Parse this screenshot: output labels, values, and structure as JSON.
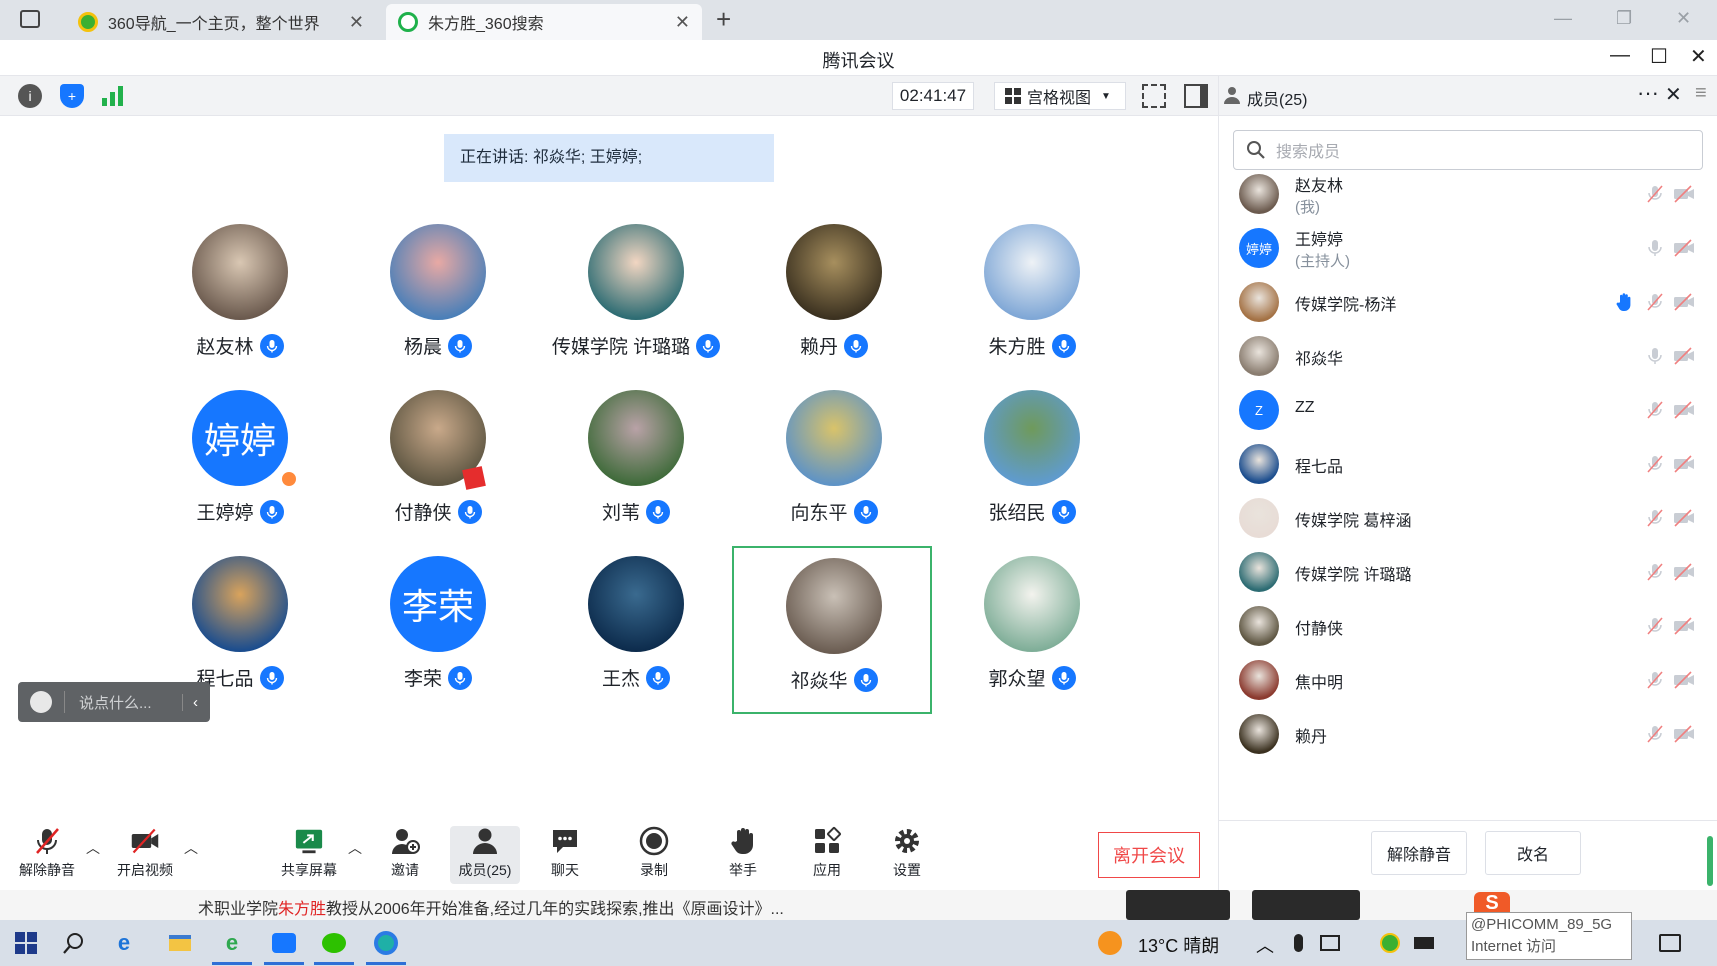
{
  "browser": {
    "tabs": [
      {
        "title": "360导航_一个主页，整个世界"
      },
      {
        "title": "朱方胜_360搜索"
      }
    ],
    "new_tab": "+"
  },
  "app": {
    "title": "腾讯会议"
  },
  "meeting": {
    "timer": "02:41:47",
    "view_mode": "宫格视图",
    "speaking_prefix": "正在讲话: ",
    "speaking_names": "祁焱华; 王婷婷;",
    "participants": [
      {
        "name": "赵友林",
        "avatar": "photo",
        "bg": "#6b5a4e",
        "bg2": "#d9c7b3"
      },
      {
        "name": "杨晨",
        "avatar": "photo",
        "bg": "#4a7fb8",
        "bg2": "#e8a9a4"
      },
      {
        "name": "传媒学院 许璐璐",
        "avatar": "photo",
        "bg": "#2d6c73",
        "bg2": "#f2d6c2"
      },
      {
        "name": "赖丹",
        "avatar": "photo",
        "bg": "#3b3120",
        "bg2": "#a78f5e"
      },
      {
        "name": "朱方胜",
        "avatar": "photo",
        "bg": "#7fa7d6",
        "bg2": "#eef2f6"
      },
      {
        "name": "王婷婷",
        "avatar": "text",
        "text": "婷婷",
        "host": true
      },
      {
        "name": "付静侠",
        "avatar": "photo",
        "bg": "#5e5642",
        "bg2": "#c9a98a",
        "flag": true
      },
      {
        "name": "刘苇",
        "avatar": "photo",
        "bg": "#3f6b3a",
        "bg2": "#b9a2a7"
      },
      {
        "name": "向东平",
        "avatar": "photo",
        "bg": "#5e93c6",
        "bg2": "#d9c36a"
      },
      {
        "name": "张绍民",
        "avatar": "photo",
        "bg": "#5f9bd0",
        "bg2": "#6f9a5b"
      },
      {
        "name": "程七品",
        "avatar": "photo",
        "bg": "#1b4d8e",
        "bg2": "#d9a35c"
      },
      {
        "name": "李荣",
        "avatar": "text",
        "text": "李荣"
      },
      {
        "name": "王杰",
        "avatar": "photo",
        "bg": "#0d2c4d",
        "bg2": "#3a6a8f"
      },
      {
        "name": "祁焱华",
        "avatar": "photo",
        "bg": "#6b5d52",
        "bg2": "#c9c0b6",
        "active": true
      },
      {
        "name": "郭众望",
        "avatar": "photo",
        "bg": "#7fae98",
        "bg2": "#f3f3ee"
      }
    ],
    "chat_placeholder": "说点什么..."
  },
  "toolbar": {
    "unmute": "解除静音",
    "video": "开启视频",
    "share": "共享屏幕",
    "invite": "邀请",
    "members": "成员(25)",
    "chat": "聊天",
    "record": "录制",
    "raise_hand": "举手",
    "apps": "应用",
    "settings": "设置",
    "leave": "离开会议"
  },
  "panel": {
    "title": "成员(25)",
    "search_placeholder": "搜索成员",
    "members": [
      {
        "name": "赵友林",
        "role": "(我)",
        "avatar": "photo",
        "bg": "#6b5a4e"
      },
      {
        "name": "王婷婷",
        "role": "(主持人)",
        "avatar": "text",
        "text": "婷婷"
      },
      {
        "name": "传媒学院-杨洋",
        "avatar": "photo",
        "bg": "#a47245",
        "hand": true
      },
      {
        "name": "祁焱华",
        "avatar": "photo",
        "bg": "#8a7d70"
      },
      {
        "name": "ZZ",
        "avatar": "text",
        "text": "Z"
      },
      {
        "name": "程七品",
        "avatar": "photo",
        "bg": "#1b4d8e"
      },
      {
        "name": "传媒学院 葛梓涵",
        "avatar": "photo",
        "bg": "#e8dcd6"
      },
      {
        "name": "传媒学院 许璐璐",
        "avatar": "photo",
        "bg": "#2d6c73"
      },
      {
        "name": "付静侠",
        "avatar": "photo",
        "bg": "#5e5642"
      },
      {
        "name": "焦中明",
        "avatar": "photo",
        "bg": "#8b3a2f"
      },
      {
        "name": "赖丹",
        "avatar": "photo",
        "bg": "#3b3120"
      }
    ],
    "unmute_all": "解除静音",
    "rename": "改名"
  },
  "ticker": {
    "prefix": "术职业学院",
    "highlight": "朱方胜",
    "suffix": "教授从2006年开始准备,经过几年的实践探索,推出《原画设计》..."
  },
  "taskbar": {
    "weather": "13°C 晴朗",
    "tooltip_line1": "@PHICOMM_89_5G",
    "tooltip_line2": "Internet 访问"
  },
  "colors": {
    "accent": "#1677ff",
    "active_border": "#3bb36b",
    "leave": "#f04848"
  }
}
